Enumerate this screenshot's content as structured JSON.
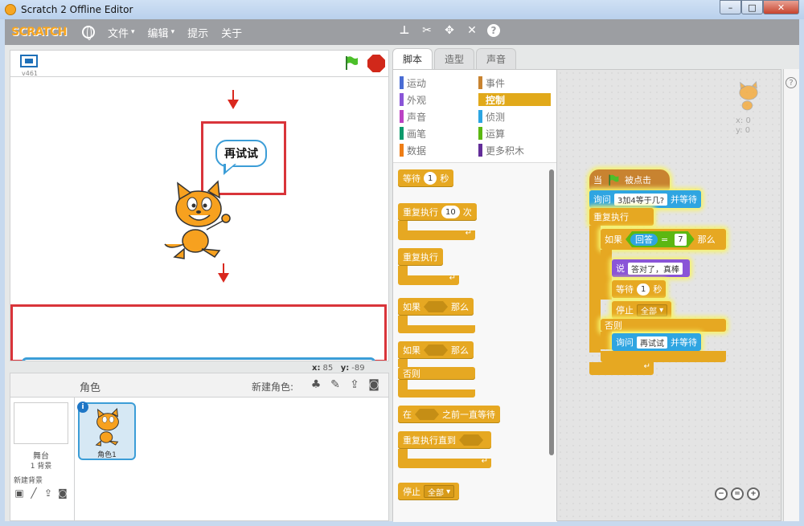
{
  "window": {
    "title": "Scratch 2 Offline Editor",
    "minimize": "–",
    "maximize": "□",
    "close": "✕"
  },
  "menubar": {
    "logo": "SCRATCH",
    "items": [
      {
        "label": "文件",
        "caret": "▾"
      },
      {
        "label": "编辑",
        "caret": "▾"
      },
      {
        "label": "提示"
      },
      {
        "label": "关于"
      }
    ],
    "tools": [
      "stamp-icon",
      "scissors-icon",
      "grow-icon",
      "shrink-icon"
    ],
    "help": "?"
  },
  "stage": {
    "version": "v461",
    "speech_bubble": "再试试",
    "ask_input_value": "",
    "coords": {
      "x_label": "x:",
      "x_value": "85",
      "y_label": "y:",
      "y_value": "-89"
    }
  },
  "sprites": {
    "title": "角色",
    "new_sprite_label": "新建角色:",
    "stage_label": "舞台",
    "backdrop_count": "1 背景",
    "new_backdrop_label": "新建背景",
    "sprite_name": "角色1",
    "info": "i"
  },
  "tabs": [
    "脚本",
    "造型",
    "声音"
  ],
  "categories": [
    {
      "label": "运动",
      "color": "#4a6cd4"
    },
    {
      "label": "事件",
      "color": "#c88330"
    },
    {
      "label": "外观",
      "color": "#8a55d7"
    },
    {
      "label": "控制",
      "color": "#e1a91a"
    },
    {
      "label": "声音",
      "color": "#bb42c3"
    },
    {
      "label": "侦测",
      "color": "#2ca5e2"
    },
    {
      "label": "画笔",
      "color": "#0e9a6c"
    },
    {
      "label": "运算",
      "color": "#5cb712"
    },
    {
      "label": "数据",
      "color": "#ee7d16"
    },
    {
      "label": "更多积木",
      "color": "#632d99"
    }
  ],
  "palette_blocks": {
    "wait": {
      "label": "等待",
      "value": "1",
      "unit": "秒"
    },
    "repeat": {
      "label": "重复执行",
      "value": "10",
      "unit": "次"
    },
    "forever": {
      "label": "重复执行"
    },
    "if_then": {
      "label": "如果",
      "then": "那么"
    },
    "if_else": {
      "label": "如果",
      "then": "那么",
      "else": "否则"
    },
    "wait_until": {
      "label": "在",
      "suffix": "之前一直等待"
    },
    "repeat_until": {
      "label": "重复执行直到"
    },
    "stop": {
      "label": "停止",
      "option": "全部"
    }
  },
  "script": {
    "when_flag": {
      "prefix": "当",
      "suffix": "被点击"
    },
    "ask1": {
      "label": "询问",
      "text": "3加4等于几?",
      "suffix": "并等待"
    },
    "forever": "重复执行",
    "if": {
      "label": "如果",
      "answer": "回答",
      "eq": "=",
      "value": "7",
      "then": "那么"
    },
    "say": {
      "label": "说",
      "text": "答对了，真棒"
    },
    "wait": {
      "label": "等待",
      "value": "1",
      "unit": "秒"
    },
    "stop": {
      "label": "停止",
      "option": "全部"
    },
    "else": "否则",
    "ask2": {
      "label": "询问",
      "text": "再试试",
      "suffix": "并等待"
    },
    "xy": {
      "x": "x: 0",
      "y": "y: 0"
    }
  },
  "colors": {
    "control": "#e6a822",
    "sensing": "#2fa5e1",
    "looks": "#8a55d7",
    "operators": "#5cb712",
    "events": "#c88330",
    "highlight": "#d9343a"
  }
}
